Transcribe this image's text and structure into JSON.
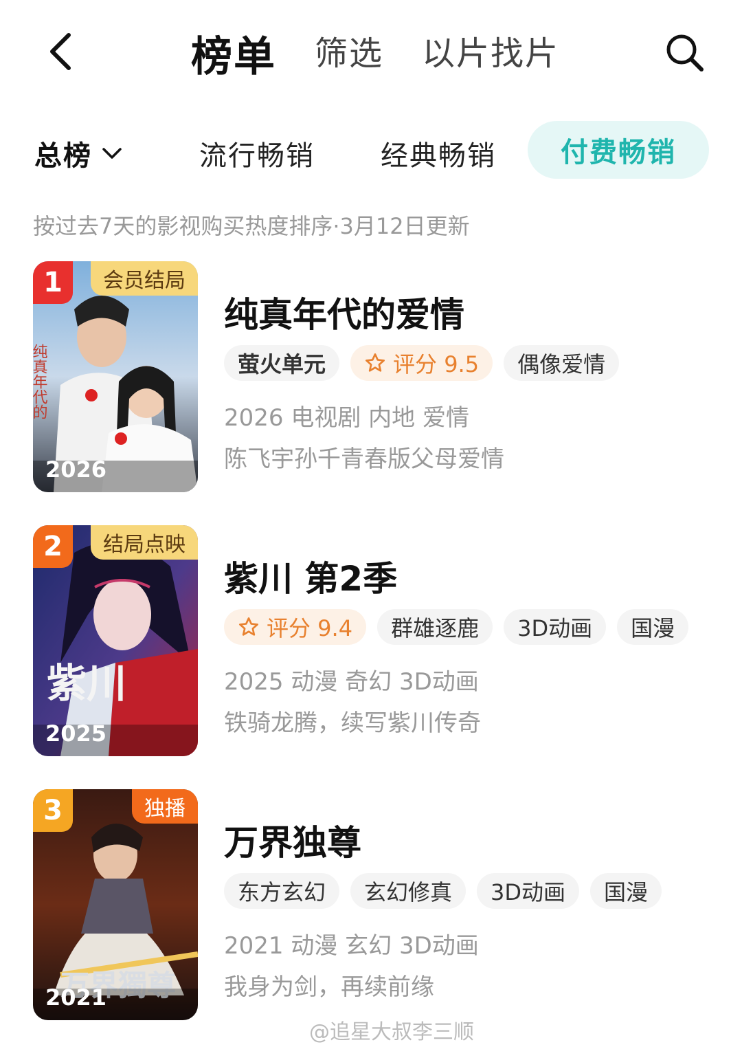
{
  "header": {
    "tabs": [
      {
        "label": "榜单",
        "active": true
      },
      {
        "label": "筛选",
        "active": false
      },
      {
        "label": "以片找片",
        "active": false
      }
    ],
    "back_icon": "chevron-left-icon",
    "search_icon": "search-icon"
  },
  "subtabs": [
    {
      "label": "总榜",
      "has_dropdown": true
    },
    {
      "label": "流行畅销"
    },
    {
      "label": "经典畅销"
    },
    {
      "label": "付费畅销",
      "active": true
    }
  ],
  "caption": "按过去7天的影视购买热度排序·3月12日更新",
  "items": [
    {
      "rank": "1",
      "rank_color": "#e8302e",
      "corner": "会员结局",
      "corner_bg": "#f7d77b",
      "corner_color": "#5b3a10",
      "year": "2026",
      "title": "纯真年代的爱情",
      "tags": [
        "萤火单元",
        "评分 9.5",
        "偶像爱情"
      ],
      "meta": "2026 电视剧 内地 爱情",
      "desc": "陈飞宇孙千青春版父母爱情"
    },
    {
      "rank": "2",
      "rank_color": "#f26a1b",
      "corner": "结局点映",
      "corner_bg": "#f7d77b",
      "corner_color": "#5b3a10",
      "year": "2025",
      "title": "紫川 第2季",
      "tags": [
        "评分 9.4",
        "群雄逐鹿",
        "3D动画",
        "国漫"
      ],
      "meta": "2025 动漫 奇幻 3D动画",
      "desc": "铁骑龙腾，续写紫川传奇"
    },
    {
      "rank": "3",
      "rank_color": "#f5a623",
      "corner": "独播",
      "corner_bg": "#f26a1b",
      "corner_color": "#ffffff",
      "year": "2021",
      "title": "万界独尊",
      "tags": [
        "东方玄幻",
        "玄幻修真",
        "3D动画",
        "国漫"
      ],
      "meta": "2021 动漫 玄幻 3D动画",
      "desc": "我身为剑，再续前缘"
    }
  ],
  "watermark": "@追星大叔李三顺",
  "colors": {
    "accent": "#1fb5ad",
    "rating": "#e8812f"
  }
}
